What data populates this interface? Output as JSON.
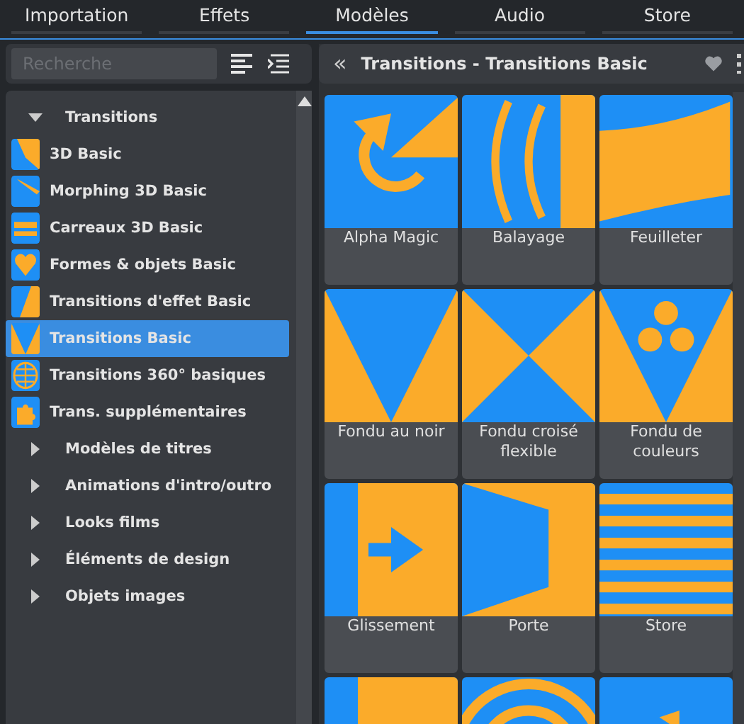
{
  "tabs": [
    {
      "label": "Importation",
      "selected": false
    },
    {
      "label": "Effets",
      "selected": false
    },
    {
      "label": "Modèles",
      "selected": true
    },
    {
      "label": "Audio",
      "selected": false
    },
    {
      "label": "Store",
      "selected": false
    }
  ],
  "search": {
    "placeholder": "Recherche"
  },
  "tree": [
    {
      "label": "Transitions",
      "expanded": true,
      "children": [
        {
          "label": "3D Basic",
          "selected": false
        },
        {
          "label": "Morphing 3D Basic",
          "selected": false
        },
        {
          "label": "Carreaux 3D Basic",
          "selected": false
        },
        {
          "label": "Formes & objets Basic",
          "selected": false
        },
        {
          "label": "Transitions d'effet Basic",
          "selected": false
        },
        {
          "label": "Transitions Basic",
          "selected": true
        },
        {
          "label": "Transitions 360° basiques",
          "selected": false
        },
        {
          "label": "Trans. supplémentaires",
          "selected": false
        }
      ]
    },
    {
      "label": "Modèles de titres",
      "expanded": false
    },
    {
      "label": "Animations d'intro/outro",
      "expanded": false
    },
    {
      "label": "Looks films",
      "expanded": false
    },
    {
      "label": "Éléments de design",
      "expanded": false
    },
    {
      "label": "Objets images",
      "expanded": false
    }
  ],
  "header": {
    "back": "«",
    "title": "Transitions - Transitions Basic"
  },
  "tiles": [
    {
      "label": "Alpha Magic"
    },
    {
      "label": "Balayage"
    },
    {
      "label": "Feuilleter"
    },
    {
      "label": "Fondu au noir"
    },
    {
      "label": "Fondu croisé flexible"
    },
    {
      "label": "Fondu de couleurs"
    },
    {
      "label": "Glissement"
    },
    {
      "label": "Porte"
    },
    {
      "label": "Store"
    },
    {
      "kind": "picture"
    },
    {
      "kind": "picture"
    },
    {
      "kind": "picture"
    }
  ]
}
